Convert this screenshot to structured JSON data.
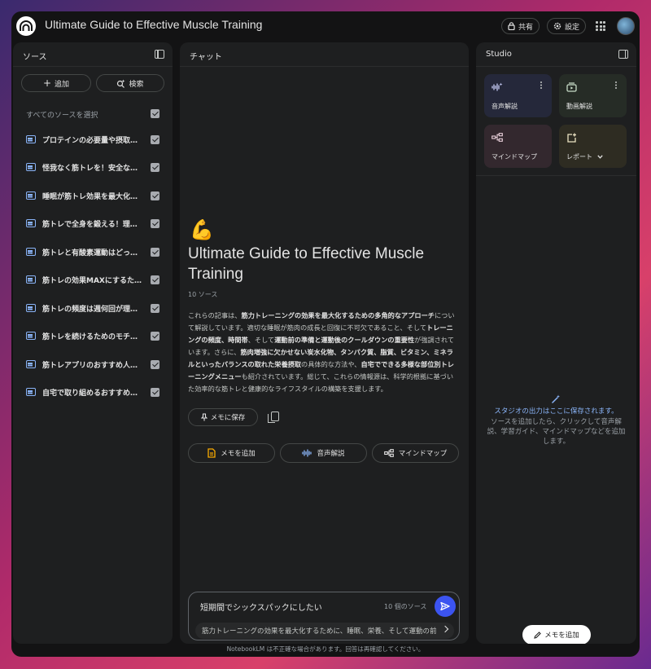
{
  "app": {
    "title": "Ultimate Guide to Effective Muscle Training",
    "share_label": "共有",
    "settings_label": "設定"
  },
  "sources": {
    "panel_title": "ソース",
    "add_label": "追加",
    "search_label": "検索",
    "select_all_label": "すべてのソースを選択",
    "items": [
      {
        "label": "プロテインの必要量や摂取タ..."
      },
      {
        "label": "怪我なく筋トレを！安全なト..."
      },
      {
        "label": "睡眠が筋トレ効果を最大化す..."
      },
      {
        "label": "筋トレで全身を鍛える！理想..."
      },
      {
        "label": "筋トレと有酸素運動はどっち..."
      },
      {
        "label": "筋トレの効果MAXにするため..."
      },
      {
        "label": "筋トレの頻度は週何回が理想..."
      },
      {
        "label": "筋トレを続けるためのモチベ..."
      },
      {
        "label": "筋トレアプリのおすすめ人気ラ..."
      },
      {
        "label": "自宅で取り組めるおすすめ筋..."
      }
    ]
  },
  "chat": {
    "panel_title": "チャット",
    "emoji": "💪",
    "notebook_title": "Ultimate Guide to Effective Muscle Training",
    "source_count": "10 ソース",
    "summary": {
      "p1": "これらの記事は、",
      "b1": "筋力トレーニングの効果を最大化するための多角的なアプローチ",
      "p2": "について解説しています。適切な睡眠が筋肉の成長と回復に不可欠であること、そして",
      "b2": "トレーニングの頻度、時間帯",
      "p3": "、そして",
      "b3": "運動前の準備と運動後のクールダウンの重要性",
      "p4": "が強調されています。さらに、",
      "b4": "筋肉増強に欠かせない炭水化物、タンパク質、脂質、ビタミン、ミネラルといったバランスの取れた栄養摂取",
      "p5": "の具体的な方法や、",
      "b5": "自宅でできる多様な部位別トレーニングメニュー",
      "p6": "も紹介されています。総じて、これらの情報源は、科学的根拠に基づいた効率的な筋トレと健康的なライフスタイルの構築を支援します。"
    },
    "save_memo_label": "メモに保存",
    "chips": [
      {
        "label": "メモを追加"
      },
      {
        "label": "音声解説"
      },
      {
        "label": "マインドマップ"
      }
    ],
    "input_value": "短期間でシックスパックにしたい",
    "input_source_count": "10 個のソース",
    "suggestion": "筋力トレーニングの効果を最大化するために、睡眠、栄養、そして運動の前"
  },
  "studio": {
    "panel_title": "Studio",
    "tiles": [
      {
        "label": "音声解説",
        "color": "#25283a"
      },
      {
        "label": "動画解説",
        "color": "#262c26"
      },
      {
        "label": "マインドマップ",
        "color": "#33282e"
      },
      {
        "label": "レポート",
        "color": "#2e2c22"
      }
    ],
    "empty_title": "スタジオの出力はここに保存されます。",
    "empty_desc": "ソースを追加したら、クリックして音声解説、学習ガイド、マインドマップなどを追加します。",
    "add_memo_label": "メモを追加"
  },
  "footer": "NotebookLM は不正確な場合があります。回答は再確認してください。",
  "colors": {
    "accent_blue": "#3c54f0",
    "link_blue": "#8ab4f8",
    "panel_bg": "#1e1f20",
    "window_bg": "#131314"
  }
}
